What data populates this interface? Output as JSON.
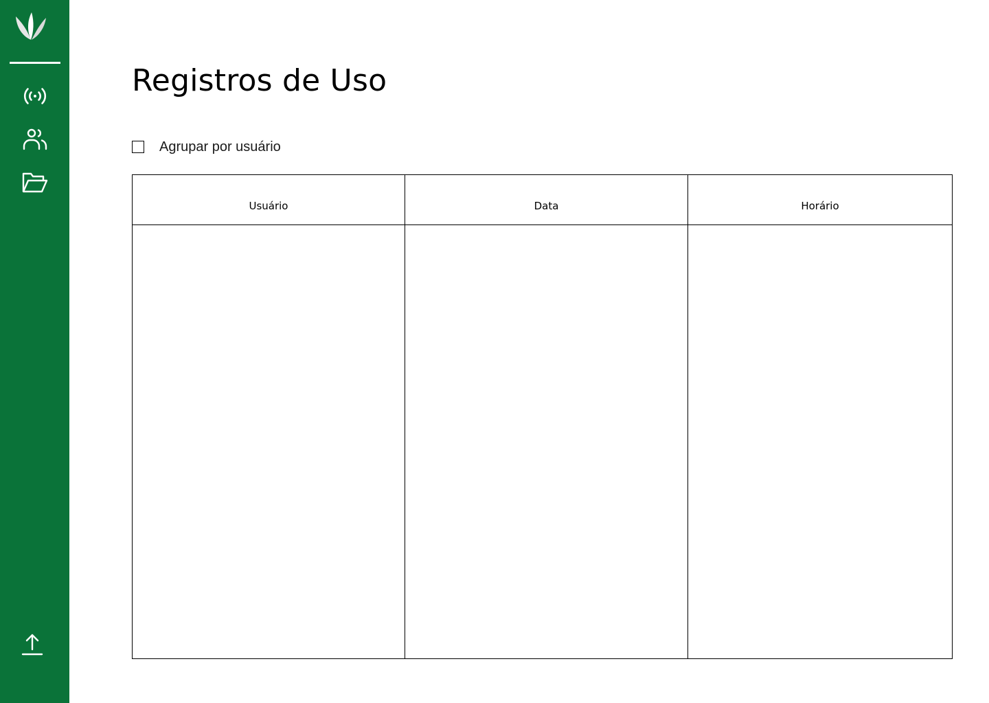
{
  "sidebar": {
    "logo": "leaf-logo",
    "items": [
      {
        "icon": "broadcast-icon"
      },
      {
        "icon": "users-icon"
      },
      {
        "icon": "folder-open-icon"
      }
    ],
    "bottom_item": {
      "icon": "upload-icon"
    },
    "background_color": "#0a7339"
  },
  "main": {
    "title": "Registros de Uso",
    "group_by_user": {
      "label": "Agrupar por usuário",
      "checked": false
    },
    "table": {
      "columns": [
        {
          "label": "Usuário"
        },
        {
          "label": "Data"
        },
        {
          "label": "Horário"
        }
      ],
      "rows": []
    }
  }
}
